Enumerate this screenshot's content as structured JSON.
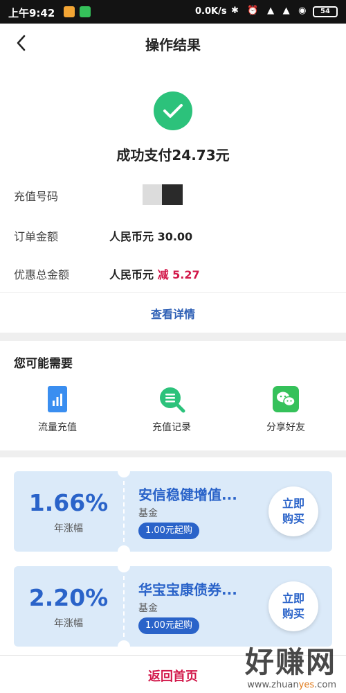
{
  "status_bar": {
    "time": "上午9:42",
    "speed": "0.0K/s",
    "system_icons": "✱ ⏰ ▲ ▲ ◉",
    "battery": "54"
  },
  "nav": {
    "title": "操作结果"
  },
  "result": {
    "pay_text": "成功支付24.73元",
    "rows": [
      {
        "label": "充值号码",
        "value": ""
      },
      {
        "label": "订单金额",
        "value": "人民币元 30.00"
      },
      {
        "label": "优惠总金额",
        "value_prefix": "人民币元 ",
        "value_minus": "减 5.27"
      }
    ],
    "details_link": "查看详情",
    "check_color": "#2cc27b"
  },
  "needs": {
    "title": "您可能需要",
    "items": [
      {
        "label": "流量充值",
        "icon": "data-recharge-icon"
      },
      {
        "label": "充值记录",
        "icon": "records-icon"
      },
      {
        "label": "分享好友",
        "icon": "wechat-share-icon"
      }
    ]
  },
  "products": [
    {
      "rate": "1.66%",
      "rate_label": "年涨幅",
      "name": "安信稳健增值...",
      "type": "基金",
      "badge": "1.00元起购",
      "buy": "立即购买"
    },
    {
      "rate": "2.20%",
      "rate_label": "年涨幅",
      "name": "华宝宝康债券...",
      "type": "基金",
      "badge": "1.00元起购",
      "buy": "立即购买"
    }
  ],
  "bottom": {
    "home": "返回首页"
  },
  "watermark": {
    "big": "好赚网",
    "small_a": "www.zhuan",
    "small_b": "yes",
    "small_c": ".com"
  },
  "colors": {
    "accent_blue": "#2a63c9",
    "accent_red": "#d2184a",
    "success_green": "#2cc27b"
  }
}
